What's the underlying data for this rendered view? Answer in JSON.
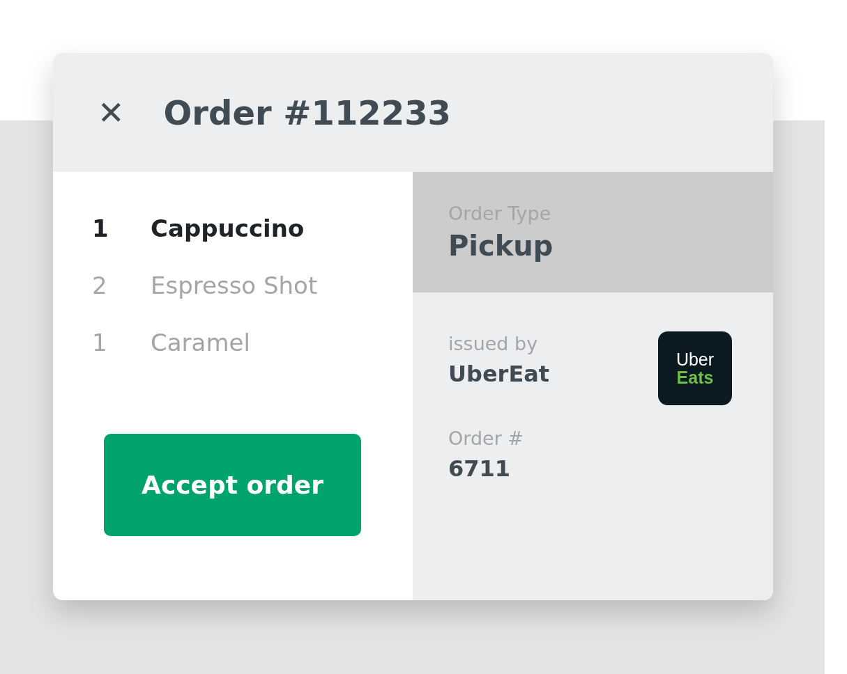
{
  "header": {
    "close_glyph": "✕",
    "title": "Order #112233"
  },
  "items": [
    {
      "qty": "1",
      "name": "Cappuccino",
      "selected": true
    },
    {
      "qty": "2",
      "name": "Espresso Shot",
      "selected": false
    },
    {
      "qty": "1",
      "name": "Caramel",
      "selected": false
    }
  ],
  "accept_button": "Accept order",
  "order_type": {
    "label": "Order Type",
    "value": "Pickup"
  },
  "issuer": {
    "label": "issued by",
    "value": "UberEat",
    "logo_line_1": "Uber",
    "logo_line_2": "Eats"
  },
  "order_number": {
    "label": "Order #",
    "value": "6711"
  }
}
